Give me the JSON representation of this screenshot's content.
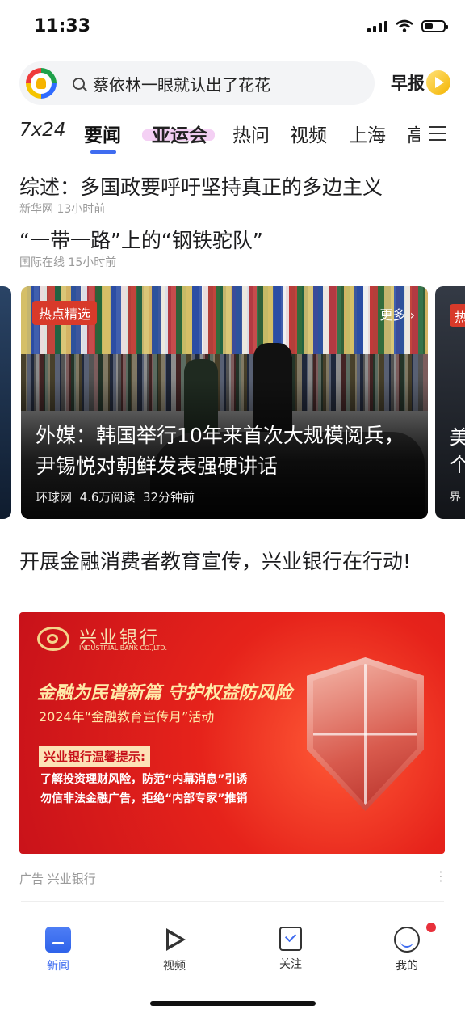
{
  "status_bar": {
    "time": "11:33"
  },
  "search": {
    "query": "蔡依林一眼就认出了花花"
  },
  "zaobao": {
    "label": "早报"
  },
  "tabs": [
    {
      "label": "7x24"
    },
    {
      "label": "要闻"
    },
    {
      "label": "亚运会"
    },
    {
      "label": "热问"
    },
    {
      "label": "视频"
    },
    {
      "label": "上海"
    },
    {
      "label": "高"
    }
  ],
  "headlines": [
    {
      "title": "综述：多国政要呼吁坚持真正的多边主义",
      "source": "新华网",
      "time": "13小时前"
    },
    {
      "title": "“一带一路”上的“钢铁驼队”",
      "source": "国际在线",
      "time": "15小时前"
    }
  ],
  "carousel": {
    "tag": "热点精选",
    "more": "更多 ›",
    "title": "外媒：韩国举行10年来首次大规模阅兵，尹锡悦对朝鲜发表强硬讲话",
    "source": "环球网",
    "reads": "4.6万阅读",
    "time": "32分钟前",
    "peek_tag": "热",
    "peek_title": "美 个",
    "peek_meta": "界"
  },
  "ad": {
    "title": "开展金融消费者教育宣传，兴业银行在行动!",
    "bank_name": "兴业银行",
    "bank_en": "INDUSTRIAL BANK CO.,LTD.",
    "slogan": "金融为民谱新篇 守护权益防风险",
    "campaign": "2024年“金融教育宣传月”活动",
    "tip_label": "兴业银行温馨提示:",
    "tip_line1": "了解投资理财风险，防范“内幕消息”引诱",
    "tip_line2": "勿信非法金融广告，拒绝“内部专家”推销",
    "meta": "广告  兴业银行",
    "more": "⋮"
  },
  "bottom_nav": [
    {
      "label": "新闻",
      "icon": "news-icon"
    },
    {
      "label": "视频",
      "icon": "video-play-icon"
    },
    {
      "label": "关注",
      "icon": "follow-icon"
    },
    {
      "label": "我的",
      "icon": "profile-icon"
    }
  ],
  "colors": {
    "accent": "#3f6cf0",
    "tag_red": "#d83a2a",
    "ad_red": "#e6231b"
  }
}
